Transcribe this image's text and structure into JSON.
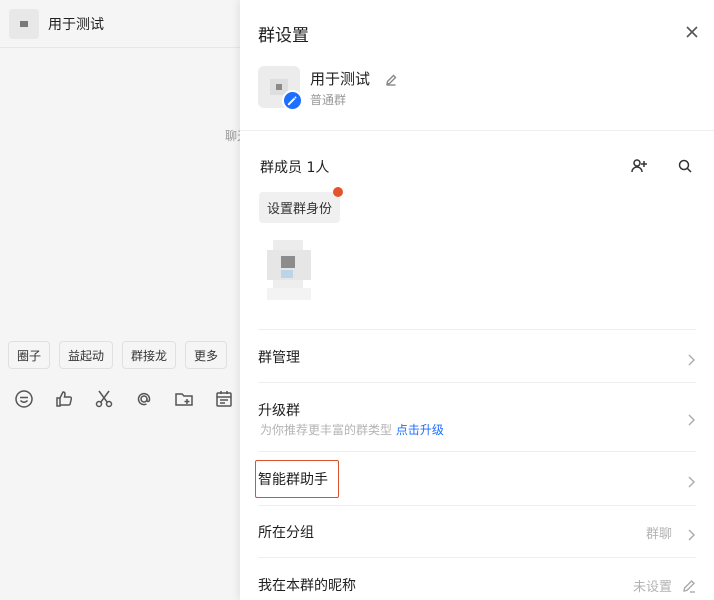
{
  "chat": {
    "title": "用于测试",
    "hint": "聊天",
    "quick_actions": [
      "圈子",
      "益起动",
      "群接龙",
      "更多"
    ],
    "toolbar_icons": [
      "emoji-icon",
      "thumbs-up-icon",
      "scissors-icon",
      "at-icon",
      "folder-plus-icon",
      "calendar-icon"
    ]
  },
  "panel": {
    "title": "群设置",
    "group_name": "用于测试",
    "group_type": "普通群",
    "members_label": "群成员 1人",
    "set_identity": "设置群身份",
    "rows": {
      "manage": "群管理",
      "upgrade": "升级群",
      "upgrade_sub": "为你推荐更丰富的群类型",
      "upgrade_link": "点击升级",
      "assistant": "智能群助手",
      "group_in": "所在分组",
      "group_in_value": "群聊",
      "nickname": "我在本群的昵称",
      "nickname_value": "未设置"
    }
  },
  "colors": {
    "accent": "#1e6fff",
    "highlight_border": "#d9532c",
    "notify_dot": "#e5532d"
  }
}
